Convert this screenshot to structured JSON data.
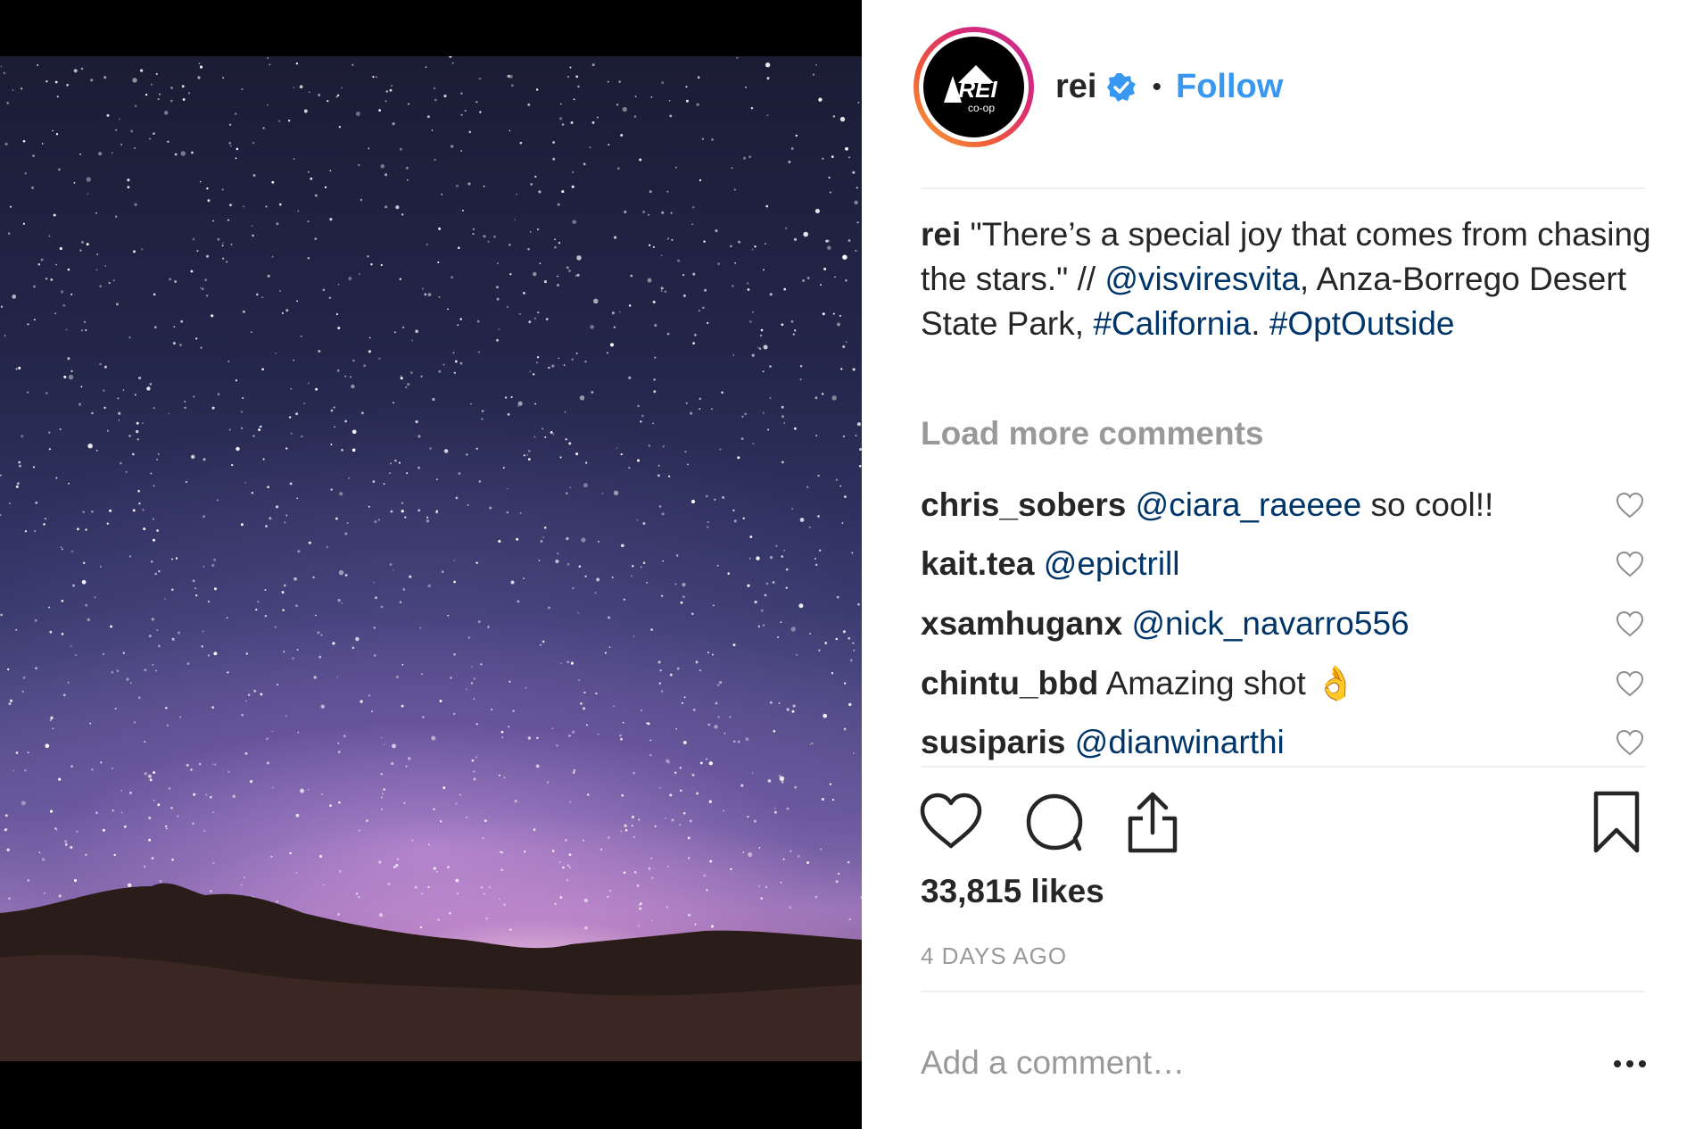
{
  "photo": {
    "alt_icon": "night-sky-photo"
  },
  "header": {
    "avatar_icon": "rei-coop-logo",
    "avatar_text_top": "REI",
    "avatar_text_bottom": "co-op",
    "username": "rei",
    "verified_icon": "verified-badge-icon",
    "separator": "•",
    "follow_label": "Follow"
  },
  "caption": {
    "user": "rei",
    "text_1": "\"There’s a special joy that comes from chasing the stars.\" // ",
    "mention": "@visviresvita",
    "text_2": ", Anza-Borrego Desert State Park, ",
    "hashtag_1": "#California",
    "text_3": ".",
    "hashtag_2": "#OptOutside"
  },
  "load_more": "Load more comments",
  "comments": [
    {
      "user": "chris_sobers",
      "mention": "@ciara_raeeee",
      "text": " so cool!!"
    },
    {
      "user": "kait.tea",
      "mention": "@epictrill",
      "text": ""
    },
    {
      "user": "xsamhuganx",
      "mention": "@nick_navarro556",
      "text": ""
    },
    {
      "user": "chintu_bbd",
      "mention": "",
      "text": "Amazing shot 👌"
    },
    {
      "user": "susiparis",
      "mention": "@dianwinarthi",
      "text": ""
    }
  ],
  "actions": {
    "like_icon": "heart-icon",
    "comment_icon": "comment-bubble-icon",
    "share_icon": "share-icon",
    "save_icon": "bookmark-icon"
  },
  "likes": "33,815 likes",
  "timestamp": "4 DAYS AGO",
  "add_comment_placeholder": "Add a comment…",
  "colors": {
    "follow": "#3897f0",
    "link": "#003569",
    "muted": "#999999",
    "text": "#262626"
  }
}
